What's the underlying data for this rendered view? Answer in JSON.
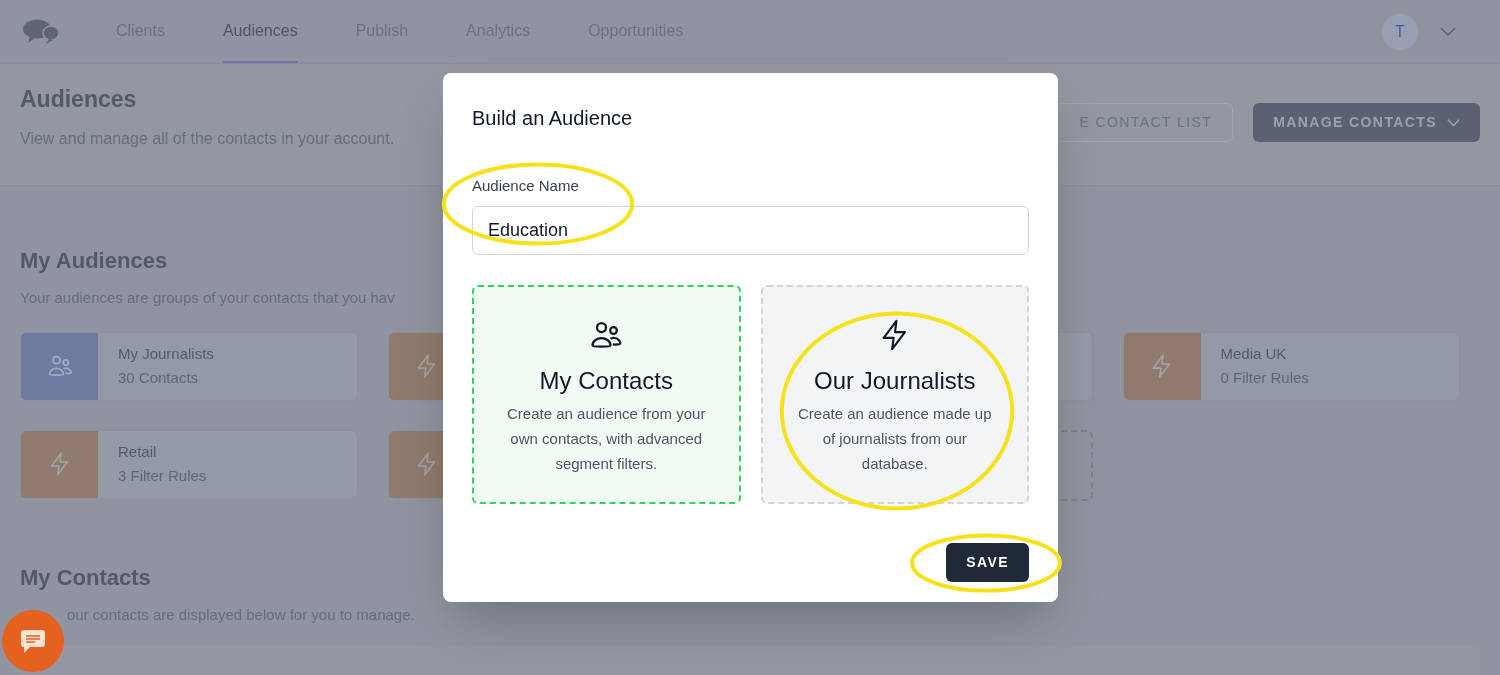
{
  "nav": {
    "items": [
      {
        "label": "Clients",
        "selected": false
      },
      {
        "label": "Audiences",
        "selected": true
      },
      {
        "label": "Publish",
        "selected": false
      },
      {
        "label": "Analytics",
        "selected": false
      },
      {
        "label": "Opportunities",
        "selected": false
      }
    ],
    "avatar": {
      "initial": "T"
    }
  },
  "header": {
    "title": "Audiences",
    "subtitle": "View and manage all of the contacts in your account.",
    "buttons": [
      {
        "label": "E CONTACT LIST",
        "kind": "outline"
      },
      {
        "label": "MANAGE CONTACTS",
        "kind": "dropdown"
      }
    ]
  },
  "my_audiences": {
    "title": "My Audiences",
    "subtitle": "Your audiences are groups of your contacts that you hav",
    "cards": [
      {
        "kind": "contacts",
        "title": "My Journalists",
        "detail": "30 Contacts"
      },
      {
        "kind": "filter"
      },
      {
        "kind": "covered"
      },
      {
        "kind": "filter",
        "title": "Media UK",
        "detail": "0 Filter Rules"
      },
      {
        "kind": "filter",
        "title": "Retail",
        "detail": "3 Filter Rules"
      },
      {
        "kind": "filter"
      },
      {
        "kind": "add"
      }
    ]
  },
  "my_contacts": {
    "title": "My Contacts",
    "subtitle": "our contacts are displayed below for you to manage."
  },
  "modal": {
    "title": "Build an Audience",
    "field": {
      "label": "Audience Name",
      "value": "Education",
      "circled": true
    },
    "options": [
      {
        "kind": "contacts",
        "title": "My Contacts",
        "description": "Create an audience from your own contacts, with advanced segment filters.",
        "selected": true,
        "circled": false
      },
      {
        "kind": "filter",
        "title": "Our Journalists",
        "description": "Create an audience made up of journalists from our database.",
        "selected": false,
        "circled": true
      }
    ],
    "save": {
      "label": "SAVE",
      "circled": true
    }
  }
}
